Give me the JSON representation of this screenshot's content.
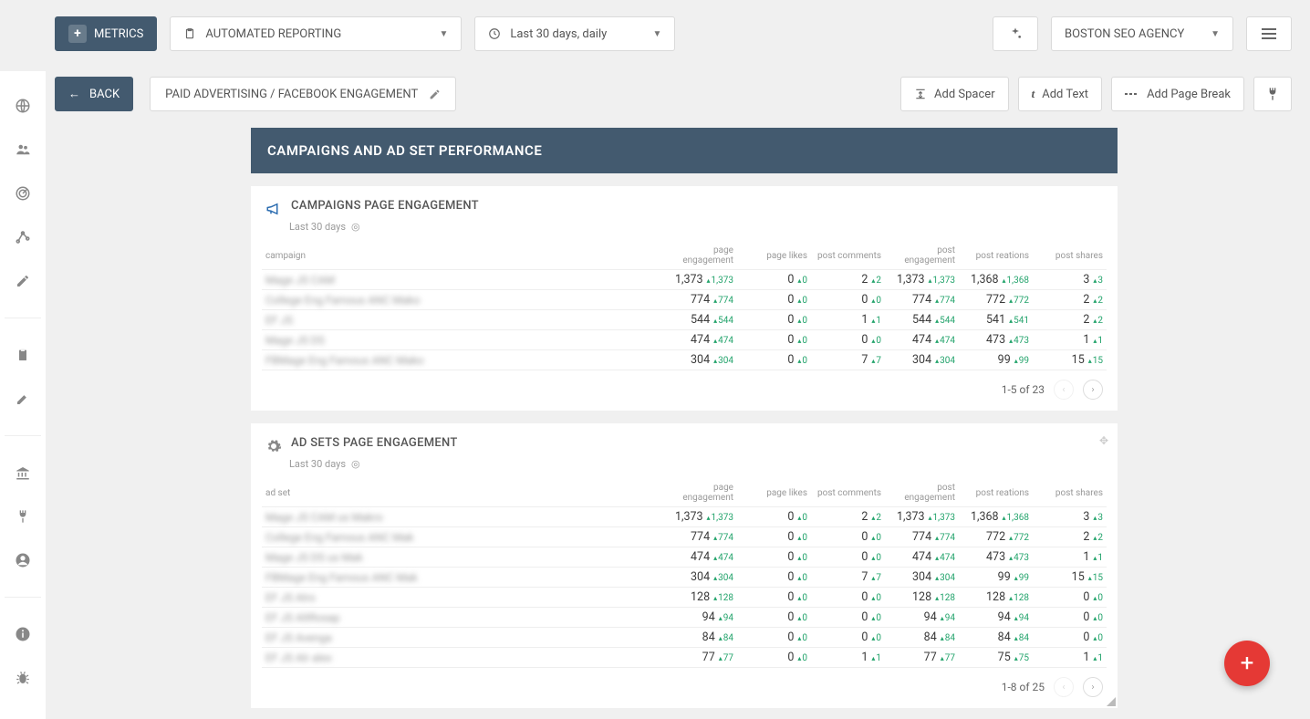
{
  "topbar": {
    "metrics_label": "METRICS",
    "report_dropdown": "AUTOMATED REPORTING",
    "date_dropdown": "Last 30 days, daily",
    "agency_dropdown": "BOSTON SEO AGENCY"
  },
  "secondbar": {
    "back_label": "BACK",
    "breadcrumb": "PAID ADVERTISING / FACEBOOK ENGAGEMENT",
    "add_spacer": "Add Spacer",
    "add_text": "Add Text",
    "add_page_break": "Add Page Break"
  },
  "section": {
    "title": "CAMPAIGNS AND AD SET PERFORMANCE"
  },
  "widgets": {
    "campaigns": {
      "title": "CAMPAIGNS PAGE ENGAGEMENT",
      "subtitle": "Last 30 days",
      "key_col": "campaign",
      "cols": [
        "page engagement",
        "page likes",
        "post comments",
        "post engagement",
        "post reations",
        "post shares"
      ],
      "rows": [
        {
          "name": "Mage JS CAM",
          "c": [
            [
              "1,373",
              "1,373"
            ],
            [
              "0",
              "0"
            ],
            [
              "2",
              "2"
            ],
            [
              "1,373",
              "1,373"
            ],
            [
              "1,368",
              "1,368"
            ],
            [
              "3",
              "3"
            ]
          ]
        },
        {
          "name": "College Eng Famous ANC Mako",
          "c": [
            [
              "774",
              "774"
            ],
            [
              "0",
              "0"
            ],
            [
              "0",
              "0"
            ],
            [
              "774",
              "774"
            ],
            [
              "772",
              "772"
            ],
            [
              "2",
              "2"
            ]
          ]
        },
        {
          "name": "EF JS",
          "c": [
            [
              "544",
              "544"
            ],
            [
              "0",
              "0"
            ],
            [
              "1",
              "1"
            ],
            [
              "544",
              "544"
            ],
            [
              "541",
              "541"
            ],
            [
              "2",
              "2"
            ]
          ]
        },
        {
          "name": "Mage JS DS",
          "c": [
            [
              "474",
              "474"
            ],
            [
              "0",
              "0"
            ],
            [
              "0",
              "0"
            ],
            [
              "474",
              "474"
            ],
            [
              "473",
              "473"
            ],
            [
              "1",
              "1"
            ]
          ]
        },
        {
          "name": "FBMage Eng Famous ANC Mako",
          "c": [
            [
              "304",
              "304"
            ],
            [
              "0",
              "0"
            ],
            [
              "7",
              "7"
            ],
            [
              "304",
              "304"
            ],
            [
              "99",
              "99"
            ],
            [
              "15",
              "15"
            ]
          ]
        }
      ],
      "pager": "1-5 of 23"
    },
    "adsets": {
      "title": "AD SETS PAGE ENGAGEMENT",
      "subtitle": "Last 30 days",
      "key_col": "ad set",
      "cols": [
        "page engagement",
        "page likes",
        "post comments",
        "post engagement",
        "post reations",
        "post shares"
      ],
      "rows": [
        {
          "name": "Mage JS CAM us Makro",
          "c": [
            [
              "1,373",
              "1,373"
            ],
            [
              "0",
              "0"
            ],
            [
              "2",
              "2"
            ],
            [
              "1,373",
              "1,373"
            ],
            [
              "1,368",
              "1,368"
            ],
            [
              "3",
              "3"
            ]
          ]
        },
        {
          "name": "College Eng Famous ANC Mak",
          "c": [
            [
              "774",
              "774"
            ],
            [
              "0",
              "0"
            ],
            [
              "0",
              "0"
            ],
            [
              "774",
              "774"
            ],
            [
              "772",
              "772"
            ],
            [
              "2",
              "2"
            ]
          ]
        },
        {
          "name": "Mage JS DS us Mak",
          "c": [
            [
              "474",
              "474"
            ],
            [
              "0",
              "0"
            ],
            [
              "0",
              "0"
            ],
            [
              "474",
              "474"
            ],
            [
              "473",
              "473"
            ],
            [
              "1",
              "1"
            ]
          ]
        },
        {
          "name": "FBMage Eng Famous ANC Mak",
          "c": [
            [
              "304",
              "304"
            ],
            [
              "0",
              "0"
            ],
            [
              "7",
              "7"
            ],
            [
              "304",
              "304"
            ],
            [
              "99",
              "99"
            ],
            [
              "15",
              "15"
            ]
          ]
        },
        {
          "name": "EF JS Alro",
          "c": [
            [
              "128",
              "128"
            ],
            [
              "0",
              "0"
            ],
            [
              "0",
              "0"
            ],
            [
              "128",
              "128"
            ],
            [
              "128",
              "128"
            ],
            [
              "0",
              "0"
            ]
          ]
        },
        {
          "name": "EF JS AltRosap",
          "c": [
            [
              "94",
              "94"
            ],
            [
              "0",
              "0"
            ],
            [
              "0",
              "0"
            ],
            [
              "94",
              "94"
            ],
            [
              "94",
              "94"
            ],
            [
              "0",
              "0"
            ]
          ]
        },
        {
          "name": "EF JS Avenga",
          "c": [
            [
              "84",
              "84"
            ],
            [
              "0",
              "0"
            ],
            [
              "0",
              "0"
            ],
            [
              "84",
              "84"
            ],
            [
              "84",
              "84"
            ],
            [
              "0",
              "0"
            ]
          ]
        },
        {
          "name": "EF JS Alr alex",
          "c": [
            [
              "77",
              "77"
            ],
            [
              "0",
              "0"
            ],
            [
              "1",
              "1"
            ],
            [
              "77",
              "77"
            ],
            [
              "75",
              "75"
            ],
            [
              "1",
              "1"
            ]
          ]
        }
      ],
      "pager": "1-8 of 25"
    }
  }
}
